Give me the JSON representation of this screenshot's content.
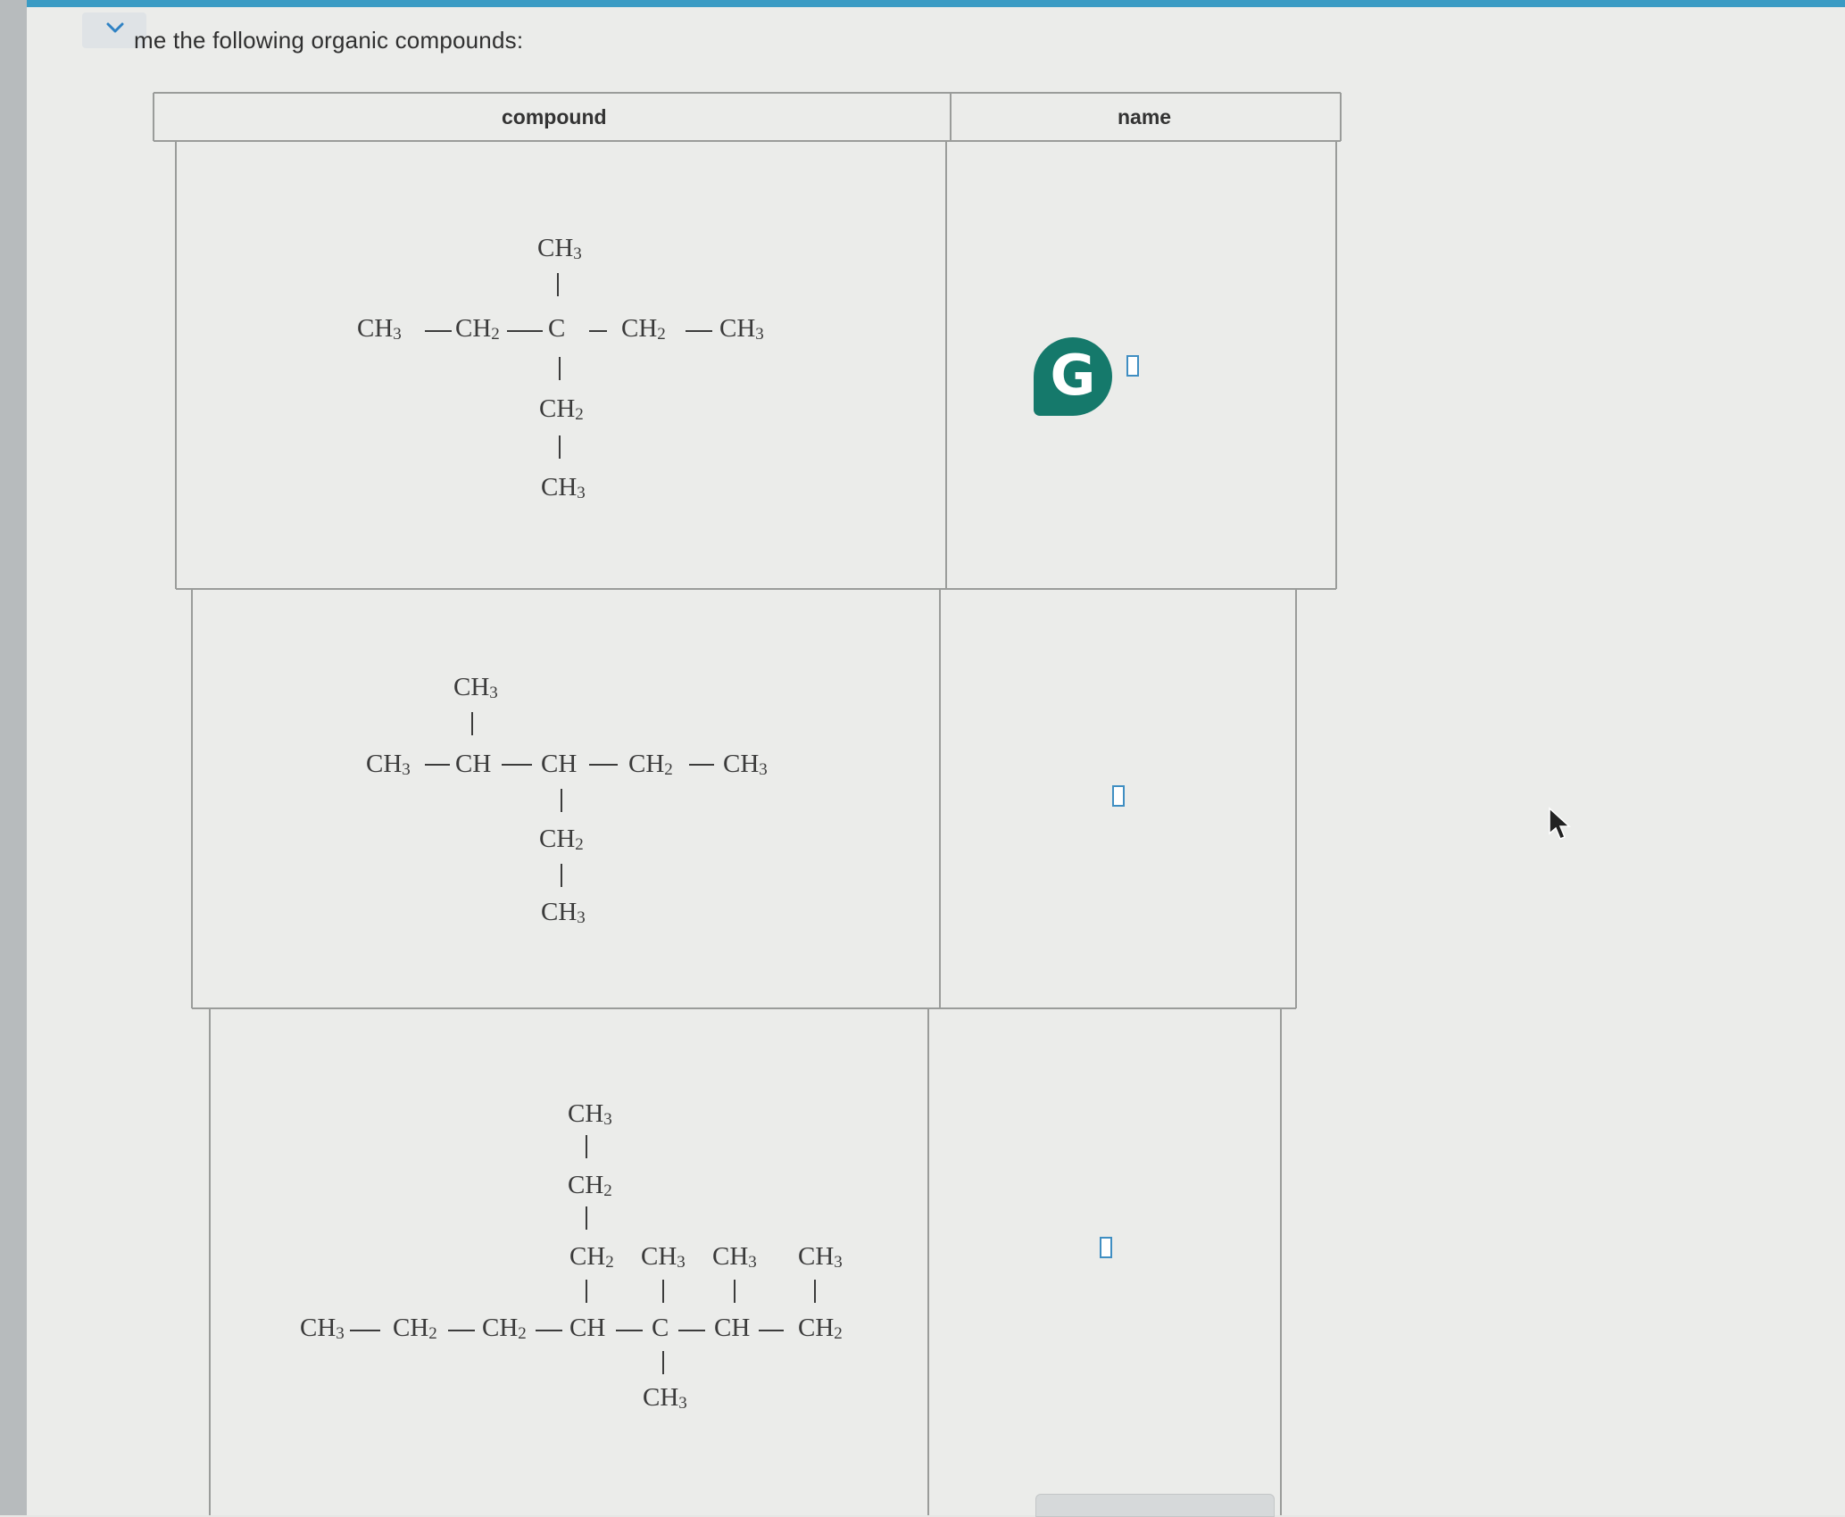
{
  "prompt": {
    "text": "me the following organic compounds:"
  },
  "table": {
    "headers": {
      "compound": "compound",
      "name": "name"
    },
    "rows": [
      {
        "formula_labels": [
          "CH3",
          "CH3",
          "CH2",
          "C",
          "CH2",
          "CH3",
          "CH2",
          "CH3"
        ],
        "name_value": ""
      },
      {
        "formula_labels": [
          "CH3",
          "CH3",
          "CH",
          "CH",
          "CH2",
          "CH3",
          "CH2",
          "CH3"
        ],
        "name_value": ""
      },
      {
        "formula_labels": [
          "CH3",
          "CH2",
          "CH2",
          "CH3",
          "CH3",
          "CH3",
          "CH3",
          "CH2",
          "CH2",
          "CH",
          "C",
          "CH",
          "CH2",
          "CH3"
        ],
        "name_value": ""
      }
    ]
  },
  "icons": {
    "expand": "chevron-down-icon",
    "grammarly": "grammarly-icon",
    "grammarly_letter": "G",
    "cursor": "mouse-pointer-icon"
  },
  "colors": {
    "accent": "#3a9bc4",
    "grammarly": "#15796b",
    "input_border": "#3f8ec2"
  }
}
